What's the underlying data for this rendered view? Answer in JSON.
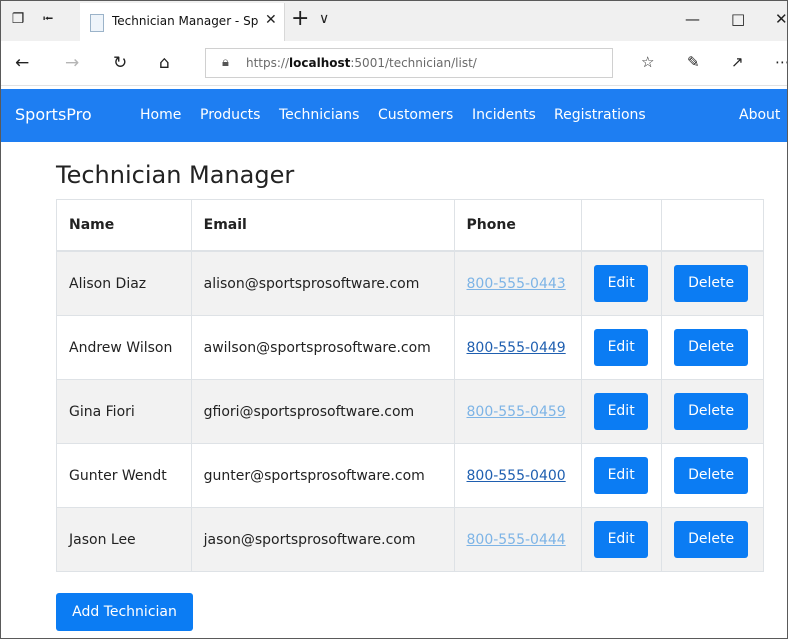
{
  "browser": {
    "tab_title": "Technician Manager - Sp",
    "url_prefix": "https://",
    "url_host": "localhost",
    "url_rest": ":5001/technician/list/"
  },
  "site": {
    "brand": "SportsPro",
    "nav": [
      "Home",
      "Products",
      "Technicians",
      "Customers",
      "Incidents",
      "Registrations"
    ],
    "about": "About"
  },
  "page": {
    "title": "Technician Manager",
    "add_label": "Add Technician"
  },
  "table": {
    "headers": [
      "Name",
      "Email",
      "Phone",
      "",
      ""
    ],
    "rows": [
      {
        "name": "Alison Diaz",
        "email": "alison@sportsprosoftware.com",
        "phone": "800-555-0443",
        "edit": "Edit",
        "delete": "Delete"
      },
      {
        "name": "Andrew Wilson",
        "email": "awilson@sportsprosoftware.com",
        "phone": "800-555-0449",
        "edit": "Edit",
        "delete": "Delete"
      },
      {
        "name": "Gina Fiori",
        "email": "gfiori@sportsprosoftware.com",
        "phone": "800-555-0459",
        "edit": "Edit",
        "delete": "Delete"
      },
      {
        "name": "Gunter Wendt",
        "email": "gunter@sportsprosoftware.com",
        "phone": "800-555-0400",
        "edit": "Edit",
        "delete": "Delete"
      },
      {
        "name": "Jason Lee",
        "email": "jason@sportsprosoftware.com",
        "phone": "800-555-0444",
        "edit": "Edit",
        "delete": "Delete"
      }
    ]
  },
  "colors": {
    "navbar": "#1e7ef2",
    "button": "#0b7cf3",
    "link": "#1f5fb0",
    "link_visited": "#7db4e6"
  }
}
